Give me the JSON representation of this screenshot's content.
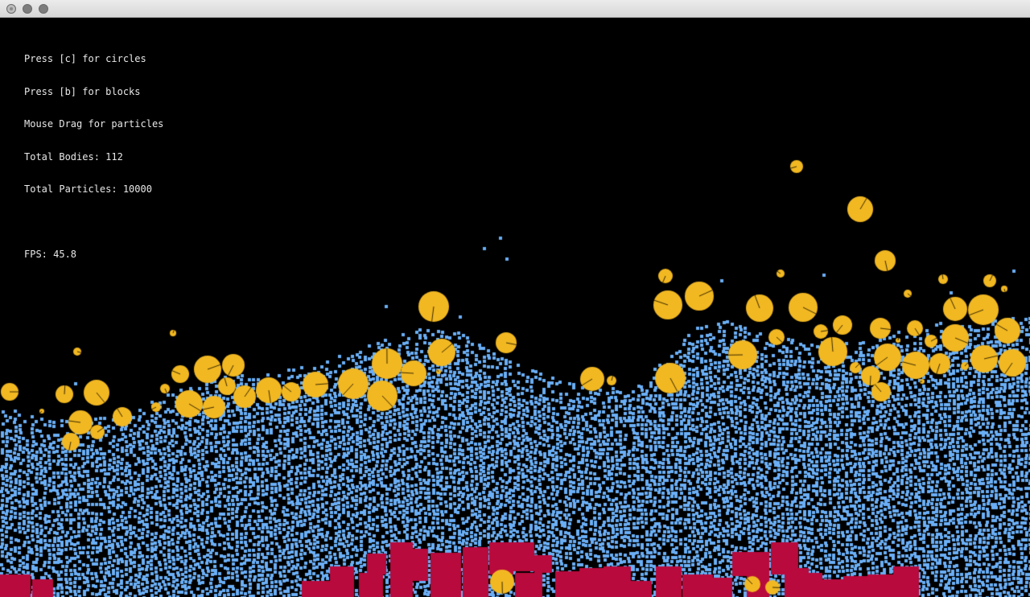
{
  "window": {
    "title": ""
  },
  "hud": {
    "line_circles": "Press [c] for circles",
    "line_blocks": "Press [b] for blocks",
    "line_drag": "Mouse Drag for particles",
    "line_bodies": "Total Bodies: 112",
    "line_particles": "Total Particles: 10000",
    "line_fps": "FPS: 45.8"
  },
  "colors": {
    "background": "#000000",
    "particle": "#6aaef5",
    "circle": "#f2b822",
    "block": "#b80a3c",
    "hud_text": "#e8e8e8"
  },
  "icons": [
    "close-icon",
    "minimize-icon",
    "zoom-icon"
  ]
}
